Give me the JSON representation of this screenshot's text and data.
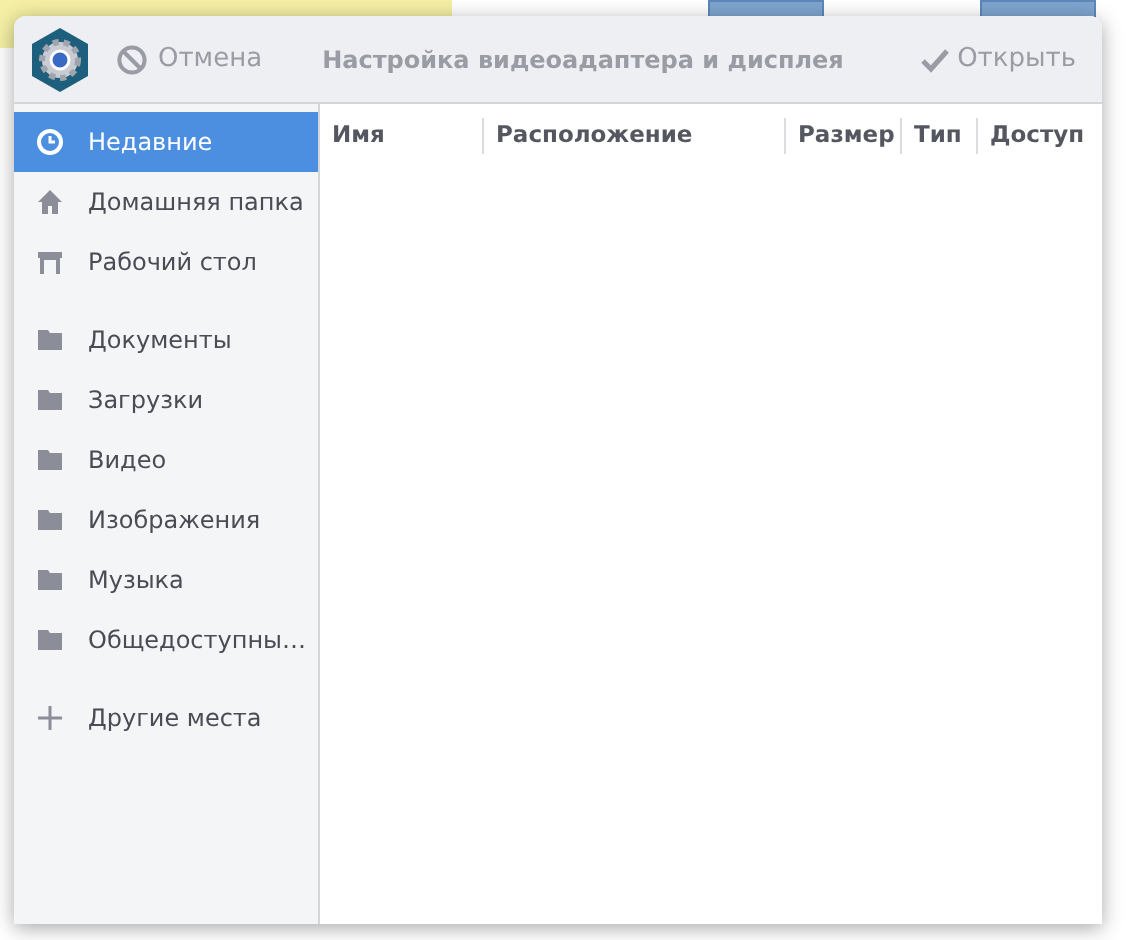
{
  "dialog": {
    "title": "Настройка видеоадаптера и дисплея",
    "cancel_button": "Отмена",
    "open_button": "Открыть",
    "sidebar": {
      "items": [
        {
          "kind": "place",
          "label": "Недавние",
          "selected": true
        },
        {
          "kind": "place",
          "label": "Домашняя папка",
          "selected": false
        },
        {
          "kind": "place",
          "label": "Рабочий стол",
          "selected": false
        },
        {
          "kind": "separator"
        },
        {
          "kind": "place",
          "label": "Документы",
          "selected": false
        },
        {
          "kind": "place",
          "label": "Загрузки",
          "selected": false
        },
        {
          "kind": "place",
          "label": "Видео",
          "selected": false
        },
        {
          "kind": "place",
          "label": "Изображения",
          "selected": false
        },
        {
          "kind": "place",
          "label": "Музыка",
          "selected": false
        },
        {
          "kind": "place",
          "label": "Общедоступны…",
          "selected": false
        },
        {
          "kind": "separator"
        },
        {
          "kind": "place",
          "label": "Другие места",
          "selected": false
        }
      ]
    },
    "table": {
      "columns": [
        "Имя",
        "Расположение",
        "Размер",
        "Тип",
        "Доступ"
      ]
    }
  }
}
